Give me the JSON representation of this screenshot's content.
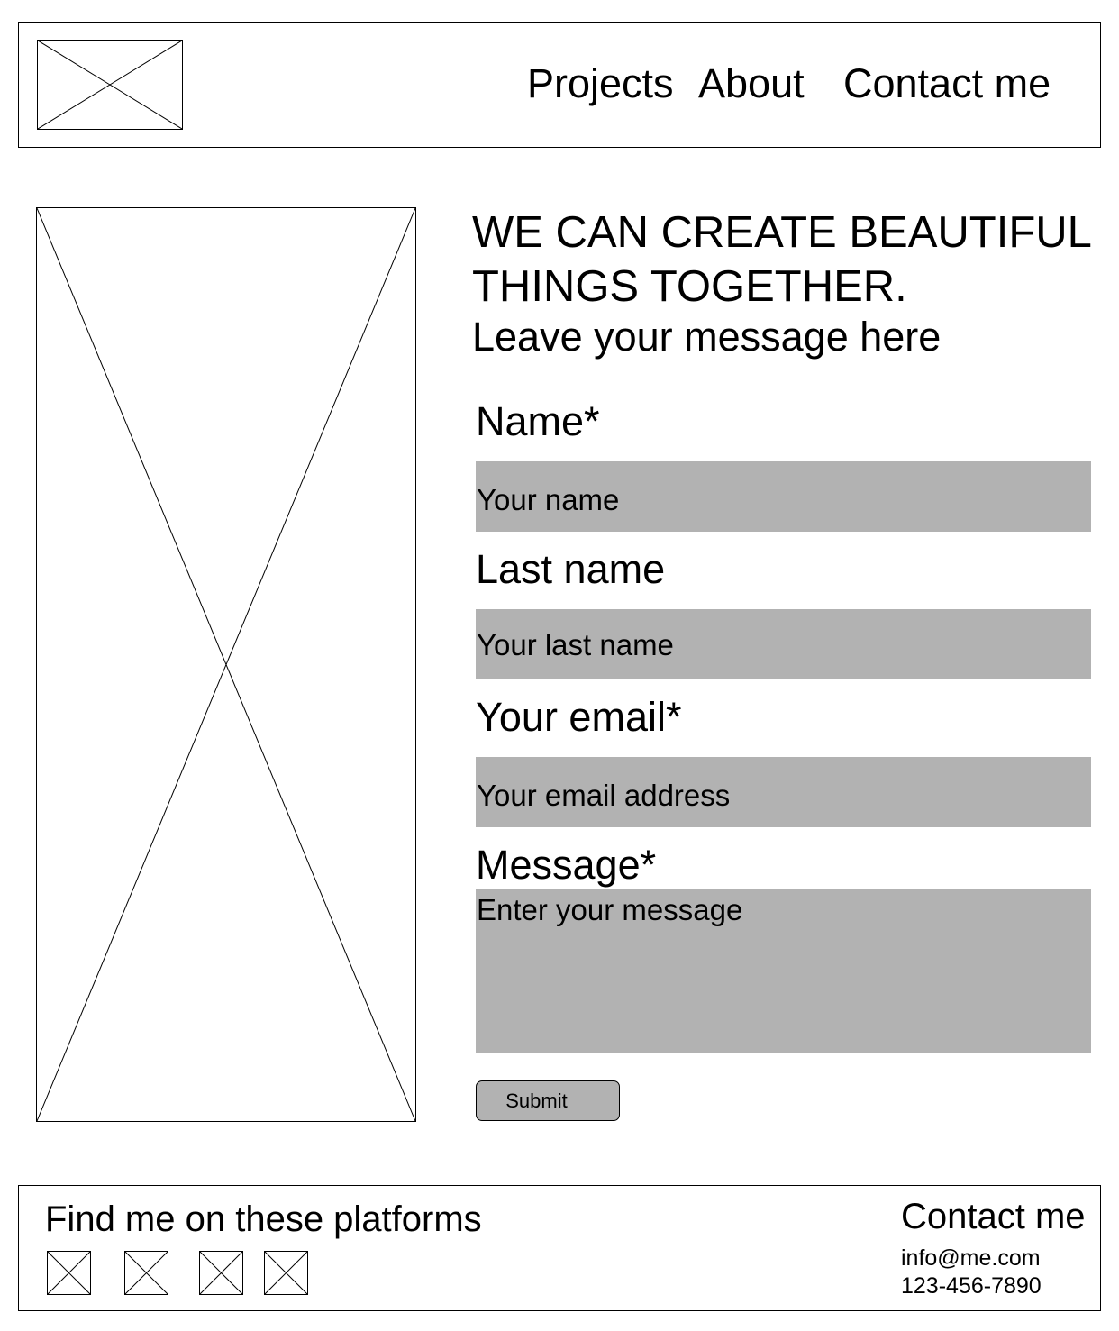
{
  "header": {
    "logo_icon": "image-placeholder-icon",
    "nav": {
      "projects": "Projects",
      "about": "About",
      "contact": "Contact me"
    }
  },
  "hero": {
    "image_icon": "image-placeholder-icon",
    "headline": "WE CAN CREATE BEAUTIFUL THINGS TOGETHER.",
    "subheadline": "Leave your message here"
  },
  "form": {
    "name": {
      "label": "Name*",
      "placeholder": "Your name"
    },
    "last_name": {
      "label": "Last name",
      "placeholder": "Your last name"
    },
    "email": {
      "label": "Your email*",
      "placeholder": "Your email address"
    },
    "message": {
      "label": "Message*",
      "placeholder": "Enter your message"
    },
    "submit_label": "Submit"
  },
  "footer": {
    "find_text": "Find me on these platforms",
    "social_icons": [
      "image-placeholder-icon",
      "image-placeholder-icon",
      "image-placeholder-icon",
      "image-placeholder-icon"
    ],
    "contact_title": "Contact me",
    "email": "info@me.com",
    "phone": "123-456-7890"
  },
  "colors": {
    "input_background": "#b2b2b2",
    "border": "#000000",
    "page_background": "#ffffff"
  }
}
